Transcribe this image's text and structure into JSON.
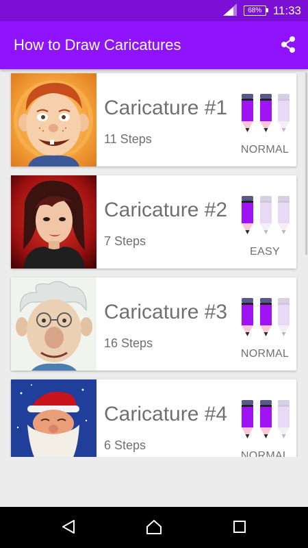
{
  "status_bar": {
    "battery": "68%",
    "time": "11:33"
  },
  "app_bar": {
    "title": "How to Draw Caricatures",
    "share_icon": "share-icon"
  },
  "colors": {
    "accent": "#9013fe",
    "pencil_active": "#a013f5",
    "pencil_inactive": "#e8d9f5"
  },
  "lessons": [
    {
      "title": "Caricature #1",
      "steps": "11 Steps",
      "difficulty": "NORMAL",
      "level": 2
    },
    {
      "title": "Caricature #2",
      "steps": "7 Steps",
      "difficulty": "EASY",
      "level": 1
    },
    {
      "title": "Caricature #3",
      "steps": "16 Steps",
      "difficulty": "NORMAL",
      "level": 2
    },
    {
      "title": "Caricature #4",
      "steps": "6 Steps",
      "difficulty": "NORMAL",
      "level": 2
    }
  ],
  "nav_bar": {
    "back_icon": "back-icon",
    "home_icon": "home-icon",
    "recents_icon": "recents-icon"
  }
}
